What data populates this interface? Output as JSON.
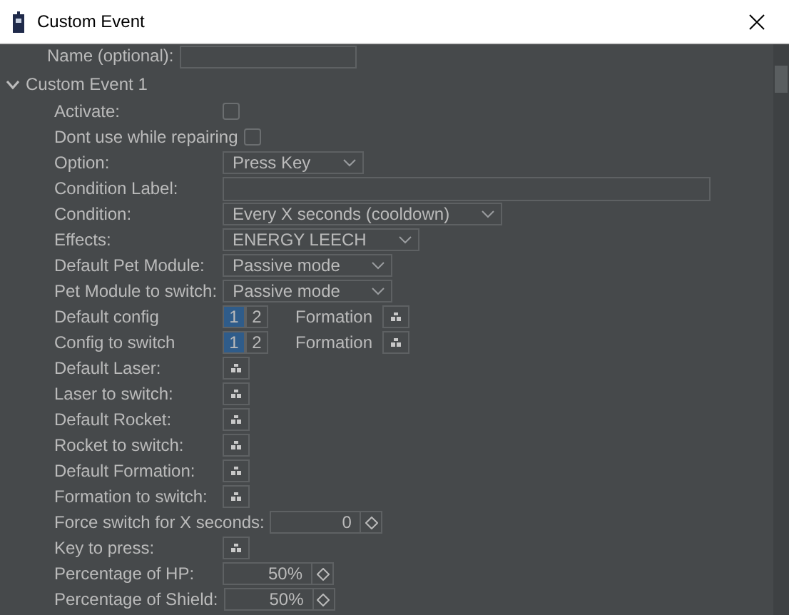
{
  "window": {
    "title": "Custom Event"
  },
  "name_row": {
    "label": "Name (optional):"
  },
  "section": {
    "title": "Custom Event 1",
    "expanded": true
  },
  "rows": [
    {
      "kind": "checkbox",
      "label": "Activate:",
      "checked": false
    },
    {
      "kind": "checkbox",
      "label": "Dont use while repairing",
      "checked": false
    },
    {
      "kind": "combo",
      "label": "Option:",
      "value": "Press Key"
    },
    {
      "kind": "text",
      "label": "Condition Label:"
    },
    {
      "kind": "combo",
      "label": "Condition:",
      "value": "Every X seconds (cooldown)"
    },
    {
      "kind": "combo",
      "label": "Effects:",
      "value": "ENERGY LEECH"
    },
    {
      "kind": "combo",
      "label": "Default Pet Module:",
      "value": "Passive mode"
    },
    {
      "kind": "combo",
      "label": "Pet Module to switch:",
      "value": "Passive mode"
    },
    {
      "kind": "config",
      "label": "Default config",
      "options": [
        {
          "label": "1",
          "selected": true
        },
        {
          "label": "2",
          "selected": false
        }
      ],
      "extra": "Formation"
    },
    {
      "kind": "config",
      "label": "Config to switch",
      "options": [
        {
          "label": "1",
          "selected": true
        },
        {
          "label": "2",
          "selected": false
        }
      ],
      "extra": "Formation"
    },
    {
      "kind": "picker",
      "label": "Default Laser:"
    },
    {
      "kind": "picker",
      "label": "Laser to switch:"
    },
    {
      "kind": "picker",
      "label": "Default Rocket:"
    },
    {
      "kind": "picker",
      "label": "Rocket to switch:"
    },
    {
      "kind": "picker",
      "label": "Default Formation:"
    },
    {
      "kind": "picker",
      "label": "Formation to switch:"
    },
    {
      "kind": "spinner",
      "label": "Force switch for X seconds:",
      "value": "0"
    },
    {
      "kind": "picker",
      "label": "Key to press:"
    },
    {
      "kind": "spinner",
      "label": "Percentage of HP:",
      "value": "50%"
    },
    {
      "kind": "spinner",
      "label": "Percentage of Shield:",
      "value": "50%"
    }
  ]
}
